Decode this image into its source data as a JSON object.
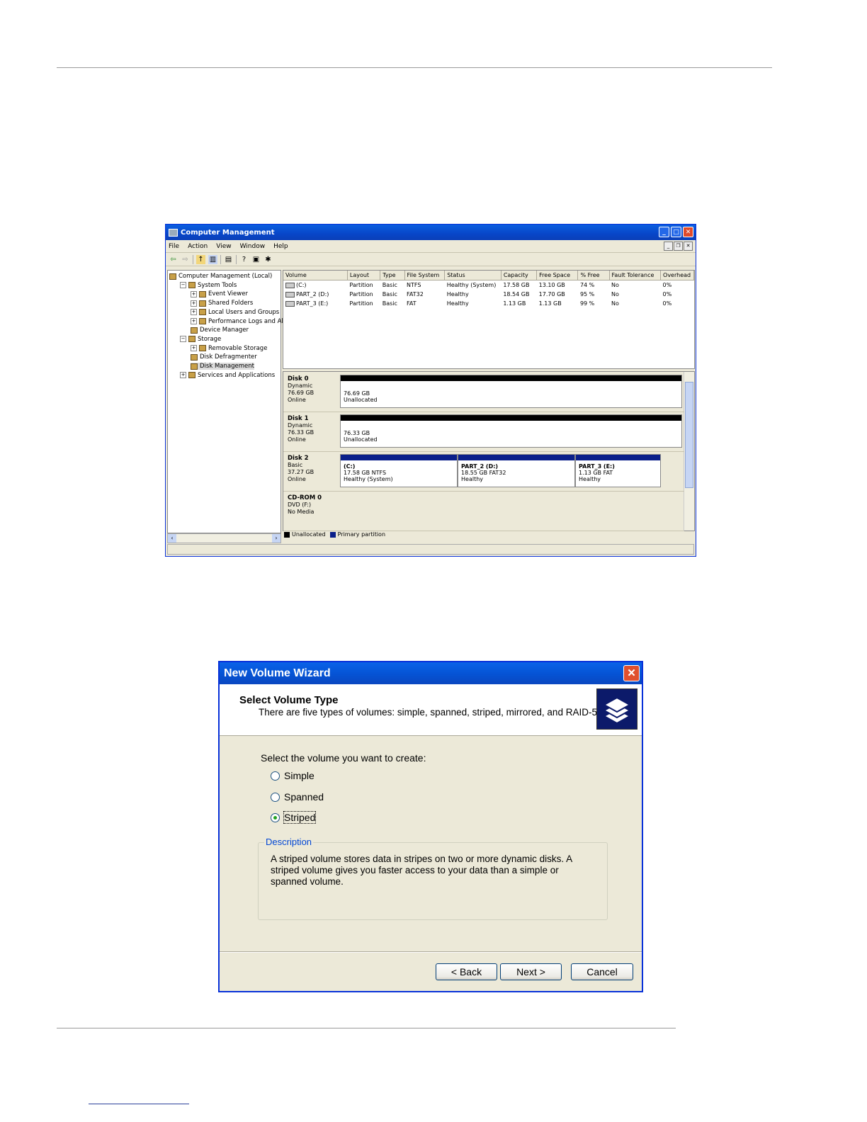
{
  "computer_management": {
    "title": "Computer Management",
    "window_buttons": [
      "_",
      "□",
      "✕"
    ],
    "menu": [
      "File",
      "Action",
      "View",
      "Window",
      "Help"
    ],
    "tree": [
      {
        "label": "Computer Management (Local)",
        "level": 0,
        "expander": "",
        "selected": false
      },
      {
        "label": "System Tools",
        "level": 1,
        "expander": "−",
        "selected": false
      },
      {
        "label": "Event Viewer",
        "level": 2,
        "expander": "+",
        "selected": false
      },
      {
        "label": "Shared Folders",
        "level": 2,
        "expander": "+",
        "selected": false
      },
      {
        "label": "Local Users and Groups",
        "level": 2,
        "expander": "+",
        "selected": false
      },
      {
        "label": "Performance Logs and Alerts",
        "level": 2,
        "expander": "+",
        "selected": false
      },
      {
        "label": "Device Manager",
        "level": 2,
        "expander": "",
        "selected": false
      },
      {
        "label": "Storage",
        "level": 1,
        "expander": "−",
        "selected": false
      },
      {
        "label": "Removable Storage",
        "level": 2,
        "expander": "+",
        "selected": false
      },
      {
        "label": "Disk Defragmenter",
        "level": 2,
        "expander": "",
        "selected": false
      },
      {
        "label": "Disk Management",
        "level": 2,
        "expander": "",
        "selected": true
      },
      {
        "label": "Services and Applications",
        "level": 1,
        "expander": "+",
        "selected": false
      }
    ],
    "volume_columns": [
      "Volume",
      "Layout",
      "Type",
      "File System",
      "Status",
      "Capacity",
      "Free Space",
      "% Free",
      "Fault Tolerance",
      "Overhead"
    ],
    "volume_rows": [
      [
        "(C:)",
        "Partition",
        "Basic",
        "NTFS",
        "Healthy (System)",
        "17.58 GB",
        "13.10 GB",
        "74 %",
        "No",
        "0%"
      ],
      [
        "PART_2 (D:)",
        "Partition",
        "Basic",
        "FAT32",
        "Healthy",
        "18.54 GB",
        "17.70 GB",
        "95 %",
        "No",
        "0%"
      ],
      [
        "PART_3 (E:)",
        "Partition",
        "Basic",
        "FAT",
        "Healthy",
        "1.13 GB",
        "1.13 GB",
        "99 %",
        "No",
        "0%"
      ]
    ],
    "disks": [
      {
        "name": "Disk 0",
        "type": "Dynamic",
        "size": "76.69 GB",
        "state": "Online",
        "partitions": [
          {
            "line1": "",
            "line2": "76.69 GB",
            "line3": "Unallocated",
            "kind": "unalloc"
          }
        ]
      },
      {
        "name": "Disk 1",
        "type": "Dynamic",
        "size": "76.33 GB",
        "state": "Online",
        "partitions": [
          {
            "line1": "",
            "line2": "76.33 GB",
            "line3": "Unallocated",
            "kind": "unalloc"
          }
        ]
      },
      {
        "name": "Disk 2",
        "type": "Basic",
        "size": "37.27 GB",
        "state": "Online",
        "partitions": [
          {
            "line1": "(C:)",
            "line2": "17.58 GB NTFS",
            "line3": "Healthy (System)",
            "kind": "prim"
          },
          {
            "line1": "PART_2 (D:)",
            "line2": "18.55 GB FAT32",
            "line3": "Healthy",
            "kind": "prim"
          },
          {
            "line1": "PART_3 (E:)",
            "line2": "1.13 GB FAT",
            "line3": "Healthy",
            "kind": "prim"
          }
        ]
      },
      {
        "name": "CD-ROM 0",
        "type": "DVD (F:)",
        "size": "",
        "state": "No Media",
        "partitions": []
      }
    ],
    "legend": [
      {
        "label": "Unallocated",
        "color": "#000000"
      },
      {
        "label": "Primary partition",
        "color": "#0a1f8a"
      }
    ]
  },
  "wizard": {
    "title": "New Volume Wizard",
    "close_glyph": "✕",
    "heading": "Select Volume Type",
    "subheading": "There are five types of volumes: simple, spanned, striped, mirrored, and RAID-5.",
    "prompt": "Select the volume you want to create:",
    "options": [
      {
        "label": "Simple",
        "selected": false
      },
      {
        "label": "Spanned",
        "selected": false
      },
      {
        "label": "Striped",
        "selected": true
      }
    ],
    "description_legend": "Description",
    "description": "A striped volume stores data in stripes on two or more dynamic disks. A striped volume gives you faster access to your data than a simple or spanned volume.",
    "buttons": {
      "back": "< Back",
      "next": "Next >",
      "cancel": "Cancel"
    },
    "colors": {
      "accent": "#0046d5",
      "title_blue": "#0553d4",
      "close_red": "#e0502e"
    }
  }
}
